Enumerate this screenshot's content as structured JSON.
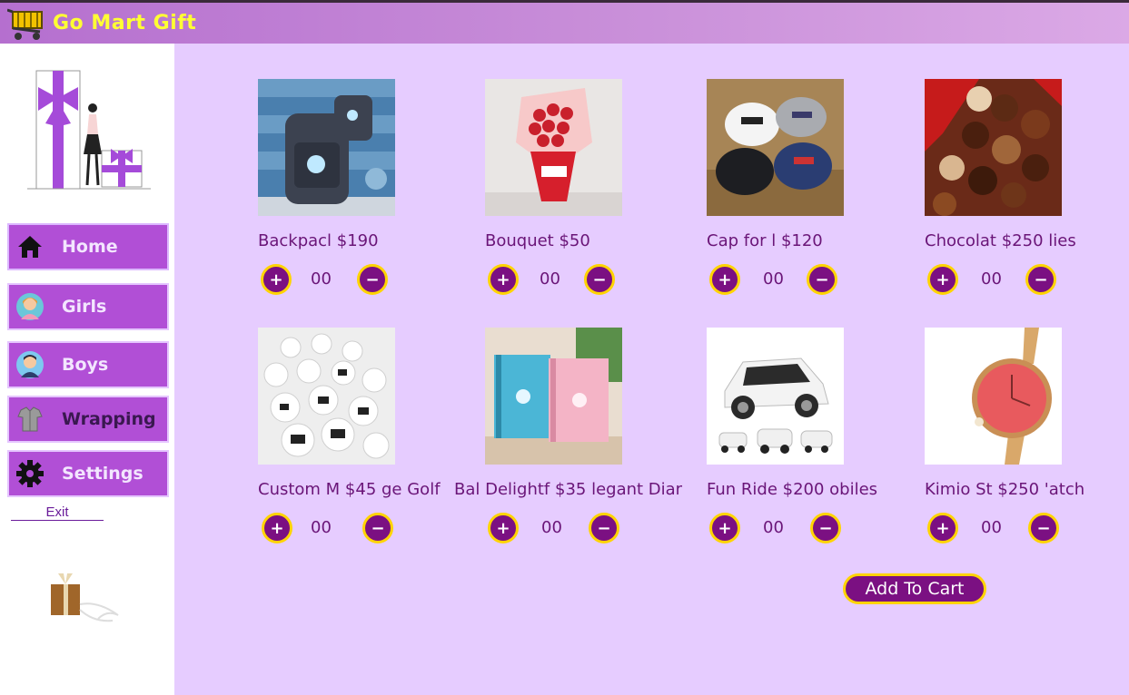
{
  "app": {
    "title": "Go Mart Gift"
  },
  "sidebar": {
    "items": [
      {
        "label": "Home",
        "icon": "house-icon"
      },
      {
        "label": "Girls",
        "icon": "girl-avatar-icon"
      },
      {
        "label": "Boys",
        "icon": "boy-avatar-icon"
      },
      {
        "label": "Wrapping",
        "icon": "shirt-wrap-icon"
      },
      {
        "label": "Settings",
        "icon": "gear-icon"
      }
    ],
    "exit_label": "Exit"
  },
  "products": [
    {
      "label": "Backpacl $190",
      "qty": "00",
      "icon": "backpack-image"
    },
    {
      "label": "Bouquet  $50",
      "qty": "00",
      "icon": "bouquet-image"
    },
    {
      "label": "Cap for l $120",
      "qty": "00",
      "icon": "caps-image"
    },
    {
      "label": "Chocolat $250 lies",
      "qty": "00",
      "icon": "chocolates-image"
    },
    {
      "label": "Custom M $45 ge Golf",
      "qty": "00",
      "icon": "golf-balls-image"
    },
    {
      "label": "Bal Delightf $35 legant Diar",
      "qty": "00",
      "icon": "diary-image"
    },
    {
      "label": "Fun Ride $200 obiles",
      "qty": "00",
      "icon": "toy-car-image"
    },
    {
      "label": "Kimio St $250 'atch",
      "qty": "00",
      "icon": "watch-image"
    }
  ],
  "controls": {
    "plus": "+",
    "minus": "−"
  },
  "cart": {
    "add_label": "Add To Cart"
  },
  "colors": {
    "sidebar_button": "#b14fd6",
    "accent": "#7b1082",
    "ring": "#ffd400",
    "content_bg": "#e6ccff",
    "title_text": "#ffff33"
  }
}
